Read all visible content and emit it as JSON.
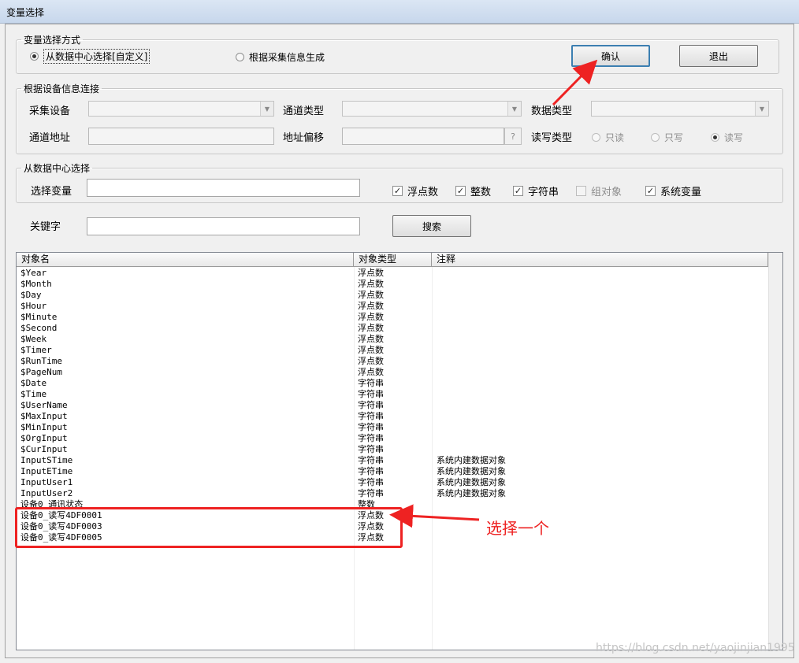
{
  "window": {
    "title": "变量选择"
  },
  "mode": {
    "legend": "变量选择方式",
    "option_datacenter": "从数据中心选择[自定义]",
    "option_collect": "根据采集信息生成",
    "confirm_label": "确认",
    "exit_label": "退出"
  },
  "device": {
    "legend": "根据设备信息连接",
    "collect_device_label": "采集设备",
    "channel_type_label": "通道类型",
    "data_type_label": "数据类型",
    "channel_address_label": "通道地址",
    "address_offset_label": "地址偏移",
    "help_label": "?",
    "rw_type_label": "读写类型",
    "read_only": "只读",
    "write_only": "只写",
    "read_write": "读写"
  },
  "datacenter": {
    "legend": "从数据中心选择",
    "select_variable_label": "选择变量",
    "float_label": "浮点数",
    "integer_label": "整数",
    "string_label": "字符串",
    "group_object_label": "组对象",
    "system_variable_label": "系统变量"
  },
  "search": {
    "keyword_label": "关键字",
    "search_label": "搜索"
  },
  "list": {
    "columns": [
      "对象名",
      "对象类型",
      "注释"
    ],
    "rows": [
      {
        "name": "$Year",
        "type": "浮点数",
        "note": ""
      },
      {
        "name": "$Month",
        "type": "浮点数",
        "note": ""
      },
      {
        "name": "$Day",
        "type": "浮点数",
        "note": ""
      },
      {
        "name": "$Hour",
        "type": "浮点数",
        "note": ""
      },
      {
        "name": "$Minute",
        "type": "浮点数",
        "note": ""
      },
      {
        "name": "$Second",
        "type": "浮点数",
        "note": ""
      },
      {
        "name": "$Week",
        "type": "浮点数",
        "note": ""
      },
      {
        "name": "$Timer",
        "type": "浮点数",
        "note": ""
      },
      {
        "name": "$RunTime",
        "type": "浮点数",
        "note": ""
      },
      {
        "name": "$PageNum",
        "type": "浮点数",
        "note": ""
      },
      {
        "name": "$Date",
        "type": "字符串",
        "note": ""
      },
      {
        "name": "$Time",
        "type": "字符串",
        "note": ""
      },
      {
        "name": "$UserName",
        "type": "字符串",
        "note": ""
      },
      {
        "name": "$MaxInput",
        "type": "字符串",
        "note": ""
      },
      {
        "name": "$MinInput",
        "type": "字符串",
        "note": ""
      },
      {
        "name": "$OrgInput",
        "type": "字符串",
        "note": ""
      },
      {
        "name": "$CurInput",
        "type": "字符串",
        "note": ""
      },
      {
        "name": "InputSTime",
        "type": "字符串",
        "note": "系统内建数据对象"
      },
      {
        "name": "InputETime",
        "type": "字符串",
        "note": "系统内建数据对象"
      },
      {
        "name": "InputUser1",
        "type": "字符串",
        "note": "系统内建数据对象"
      },
      {
        "name": "InputUser2",
        "type": "字符串",
        "note": "系统内建数据对象"
      },
      {
        "name": "设备0_通讯状态",
        "type": "整数",
        "note": ""
      },
      {
        "name": "设备0_读写4DF0001",
        "type": "浮点数",
        "note": ""
      },
      {
        "name": "设备0_读写4DF0003",
        "type": "浮点数",
        "note": ""
      },
      {
        "name": "设备0_读写4DF0005",
        "type": "浮点数",
        "note": ""
      }
    ]
  },
  "annotation": {
    "callout_text": "选择一个",
    "color": "#ee2222"
  },
  "watermark": "https://blog.csdn.net/yaojinjian1995"
}
